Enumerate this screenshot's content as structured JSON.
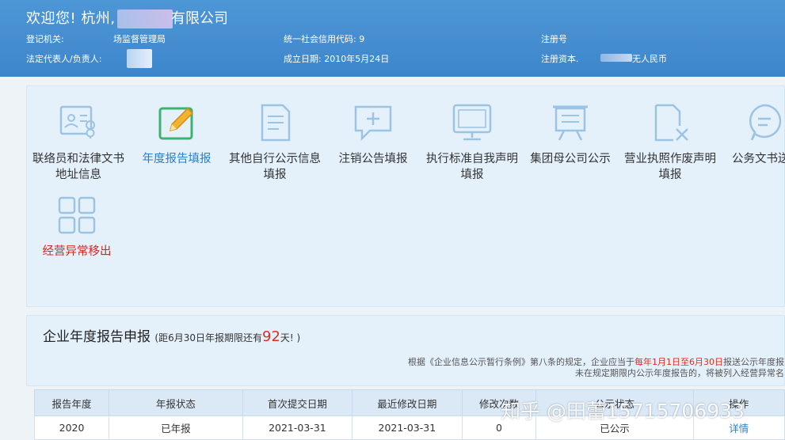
{
  "header": {
    "welcome": "欢迎您! 杭州,",
    "company_suffix": "有限公司",
    "reg_authority_label": "登记机关:",
    "reg_authority_value": "场监督管理局",
    "credit_code_label": "统一社会信用代码: 9",
    "reg_no_label": "注册号",
    "legal_rep_label": "法定代表人/负责人:",
    "established_label": "成立日期: 2010年5月24日",
    "capital_label": "注册资本.",
    "capital_value": "无人民币"
  },
  "tiles": [
    {
      "label": "联络员和法律文书地址信息",
      "icon": "contact-card-icon"
    },
    {
      "label": "年度报告填报",
      "icon": "edit-pencil-icon"
    },
    {
      "label": "其他自行公示信息填报",
      "icon": "document-icon"
    },
    {
      "label": "注销公告填报",
      "icon": "chat-plus-icon"
    },
    {
      "label": "执行标准自我声明填报",
      "icon": "monitor-icon"
    },
    {
      "label": "集团母公司公示",
      "icon": "board-icon"
    },
    {
      "label": "营业执照作废声明填报",
      "icon": "file-x-icon"
    },
    {
      "label": "公务文书送",
      "icon": "message-bubble-icon"
    },
    {
      "label": "经营异常移出",
      "icon": "grid-icon"
    }
  ],
  "report": {
    "title": "企业年度报告申报",
    "countdown_prefix": "(距6月30日年报期限还有",
    "days": "92",
    "countdown_suffix": "天! )",
    "notice1_a": "根据《企业信息公示暂行条例》第八条的规定，企业应当于",
    "notice1_b": "每年1月1日至6月30日",
    "notice1_c": "报送公示年度报",
    "notice2": "未在规定期限内公示年度报告的，将被列入经营异常名"
  },
  "table": {
    "headers": [
      "报告年度",
      "年报状态",
      "首次提交日期",
      "最近修改日期",
      "修改次数",
      "公示状态",
      "操作"
    ],
    "rows": [
      [
        "2020",
        "已年报",
        "2021-03-31",
        "2021-03-31",
        "0",
        "已公示",
        "详情"
      ]
    ]
  },
  "watermark": "知乎 @田蕾15715706933"
}
